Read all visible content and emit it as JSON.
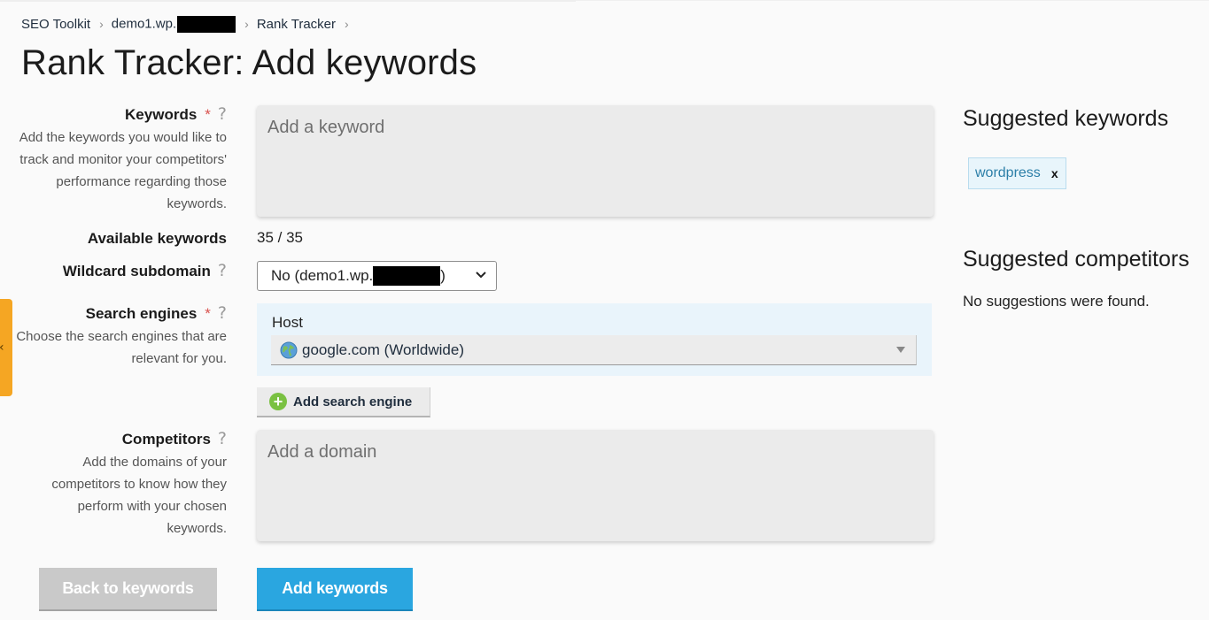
{
  "breadcrumb": {
    "items": [
      {
        "label": "SEO Toolkit"
      },
      {
        "label": "demo1.wp."
      },
      {
        "label": "Rank Tracker"
      }
    ]
  },
  "page": {
    "title": "Rank Tracker: Add keywords"
  },
  "keywords": {
    "label": "Keywords",
    "required_mark": "*",
    "help": "?",
    "description": "Add the keywords you would like to track and monitor your competitors' performance regarding those keywords.",
    "placeholder": "Add a keyword"
  },
  "available": {
    "label": "Available keywords",
    "value": "35 / 35"
  },
  "wildcard": {
    "label": "Wildcard subdomain",
    "help": "?",
    "selected_prefix": "No (demo1.wp.",
    "selected_suffix": ")"
  },
  "search_engines": {
    "label": "Search engines",
    "required_mark": "*",
    "help": "?",
    "description": "Choose the search engines that are relevant for you.",
    "host_label": "Host",
    "selected": "google.com (Worldwide)",
    "add_button": "Add search engine"
  },
  "competitors": {
    "label": "Competitors",
    "help": "?",
    "description": "Add the domains of your competitors to know how they perform with your chosen keywords.",
    "placeholder": "Add a domain"
  },
  "actions": {
    "back_label": "Back to keywords",
    "submit_label": "Add keywords"
  },
  "sidebar": {
    "suggested_keywords_title": "Suggested keywords",
    "suggested_keywords": [
      {
        "label": "wordpress",
        "remove": "x"
      }
    ],
    "suggested_competitors_title": "Suggested competitors",
    "no_suggestions": "No suggestions were found."
  },
  "side_tab": {
    "arrow": "‹"
  },
  "colors": {
    "primary_button": "#2aa6e0",
    "disabled_button": "#c9c9c9",
    "required": "#d9534f",
    "engine_panel": "#e9f4fb",
    "side_tab": "#f5a623",
    "add_icon": "#7ac142",
    "tag_text": "#2c7fa8"
  },
  "icons": {
    "breadcrumb_separator": "chevron-right-icon",
    "select_arrow": "chevron-down-icon",
    "engine": "globe-icon",
    "add": "plus-circle-icon"
  }
}
